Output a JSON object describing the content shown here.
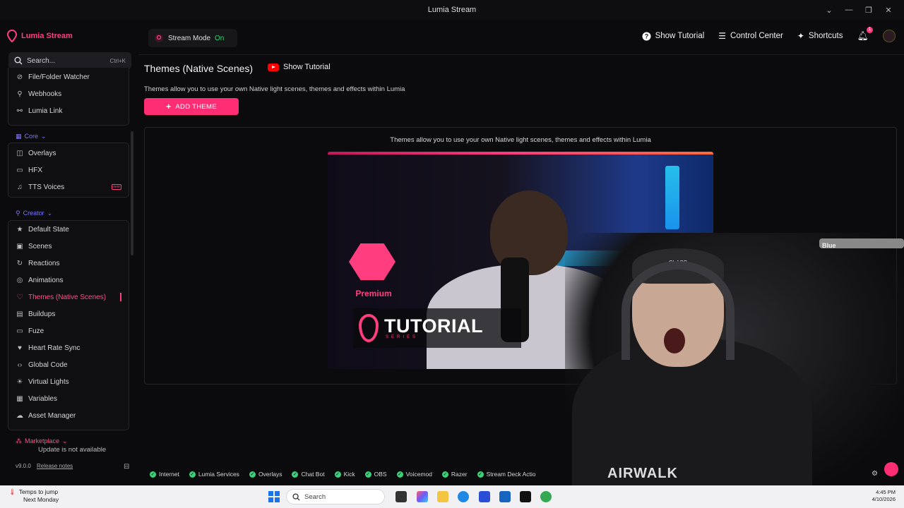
{
  "window": {
    "title": "Lumia Stream"
  },
  "sidebar": {
    "brand": "Lumia Stream",
    "search_placeholder": "Search...",
    "search_shortcut": "Ctrl+K",
    "top_items": [
      {
        "label": "File/Folder Watcher",
        "icon": "eye-icon"
      },
      {
        "label": "Webhooks",
        "icon": "webhook-icon"
      },
      {
        "label": "Lumia Link",
        "icon": "link-icon"
      }
    ],
    "core_label": "Core",
    "core_items": [
      {
        "label": "Overlays",
        "icon": "layers-icon"
      },
      {
        "label": "HFX",
        "icon": "monitor-icon"
      },
      {
        "label": "TTS Voices",
        "icon": "mic-icon",
        "badge": "new"
      }
    ],
    "creator_label": "Creator",
    "creator_items": [
      {
        "label": "Default State",
        "icon": "star-icon"
      },
      {
        "label": "Scenes",
        "icon": "image-icon"
      },
      {
        "label": "Reactions",
        "icon": "refresh-icon"
      },
      {
        "label": "Animations",
        "icon": "animation-icon"
      },
      {
        "label": "Themes (Native Scenes)",
        "icon": "pin-icon",
        "active": true
      },
      {
        "label": "Buildups",
        "icon": "buildups-icon"
      },
      {
        "label": "Fuze",
        "icon": "monitor-icon"
      },
      {
        "label": "Heart Rate Sync",
        "icon": "heart-icon"
      },
      {
        "label": "Global Code",
        "icon": "code-icon"
      },
      {
        "label": "Virtual Lights",
        "icon": "sun-icon"
      },
      {
        "label": "Variables",
        "icon": "variables-icon"
      },
      {
        "label": "Asset Manager",
        "icon": "cloud-icon"
      }
    ],
    "marketplace_label": "Marketplace",
    "update_text": "Update is not available",
    "version": "v9.0.0",
    "release_notes": "Release notes"
  },
  "topbar": {
    "stream_mode_label": "Stream Mode",
    "stream_mode_value": "On",
    "show_tutorial": "Show Tutorial",
    "control_center": "Control Center",
    "shortcuts": "Shortcuts",
    "notification_count": "1"
  },
  "main": {
    "title": "Themes (Native Scenes)",
    "tutorial_link": "Show Tutorial",
    "description": "Themes allow you to use your own Native light scenes, themes and effects within Lumia",
    "add_button": "ADD THEME",
    "panel_description": "Themes allow you to use your own Native light scenes, themes and effects within Lumia",
    "video": {
      "badge_text": "Premium",
      "title": "TUTORIAL",
      "subtitle": "SERIES"
    }
  },
  "camera": {
    "mic_brand": "Blue",
    "hat_text": "CLASS",
    "hoodie_text": "AIRWALK"
  },
  "statusbar": {
    "items": [
      "Internet",
      "Lumia Services",
      "Overlays",
      "Chat Bot",
      "Kick",
      "OBS",
      "Voicemod",
      "Razer",
      "Stream Deck Actio"
    ]
  },
  "taskbar": {
    "weather_line1": "Temps to jump",
    "weather_line2": "Next Monday",
    "search": "Search",
    "time": "4:45 PM",
    "date": "4/10/2026"
  }
}
